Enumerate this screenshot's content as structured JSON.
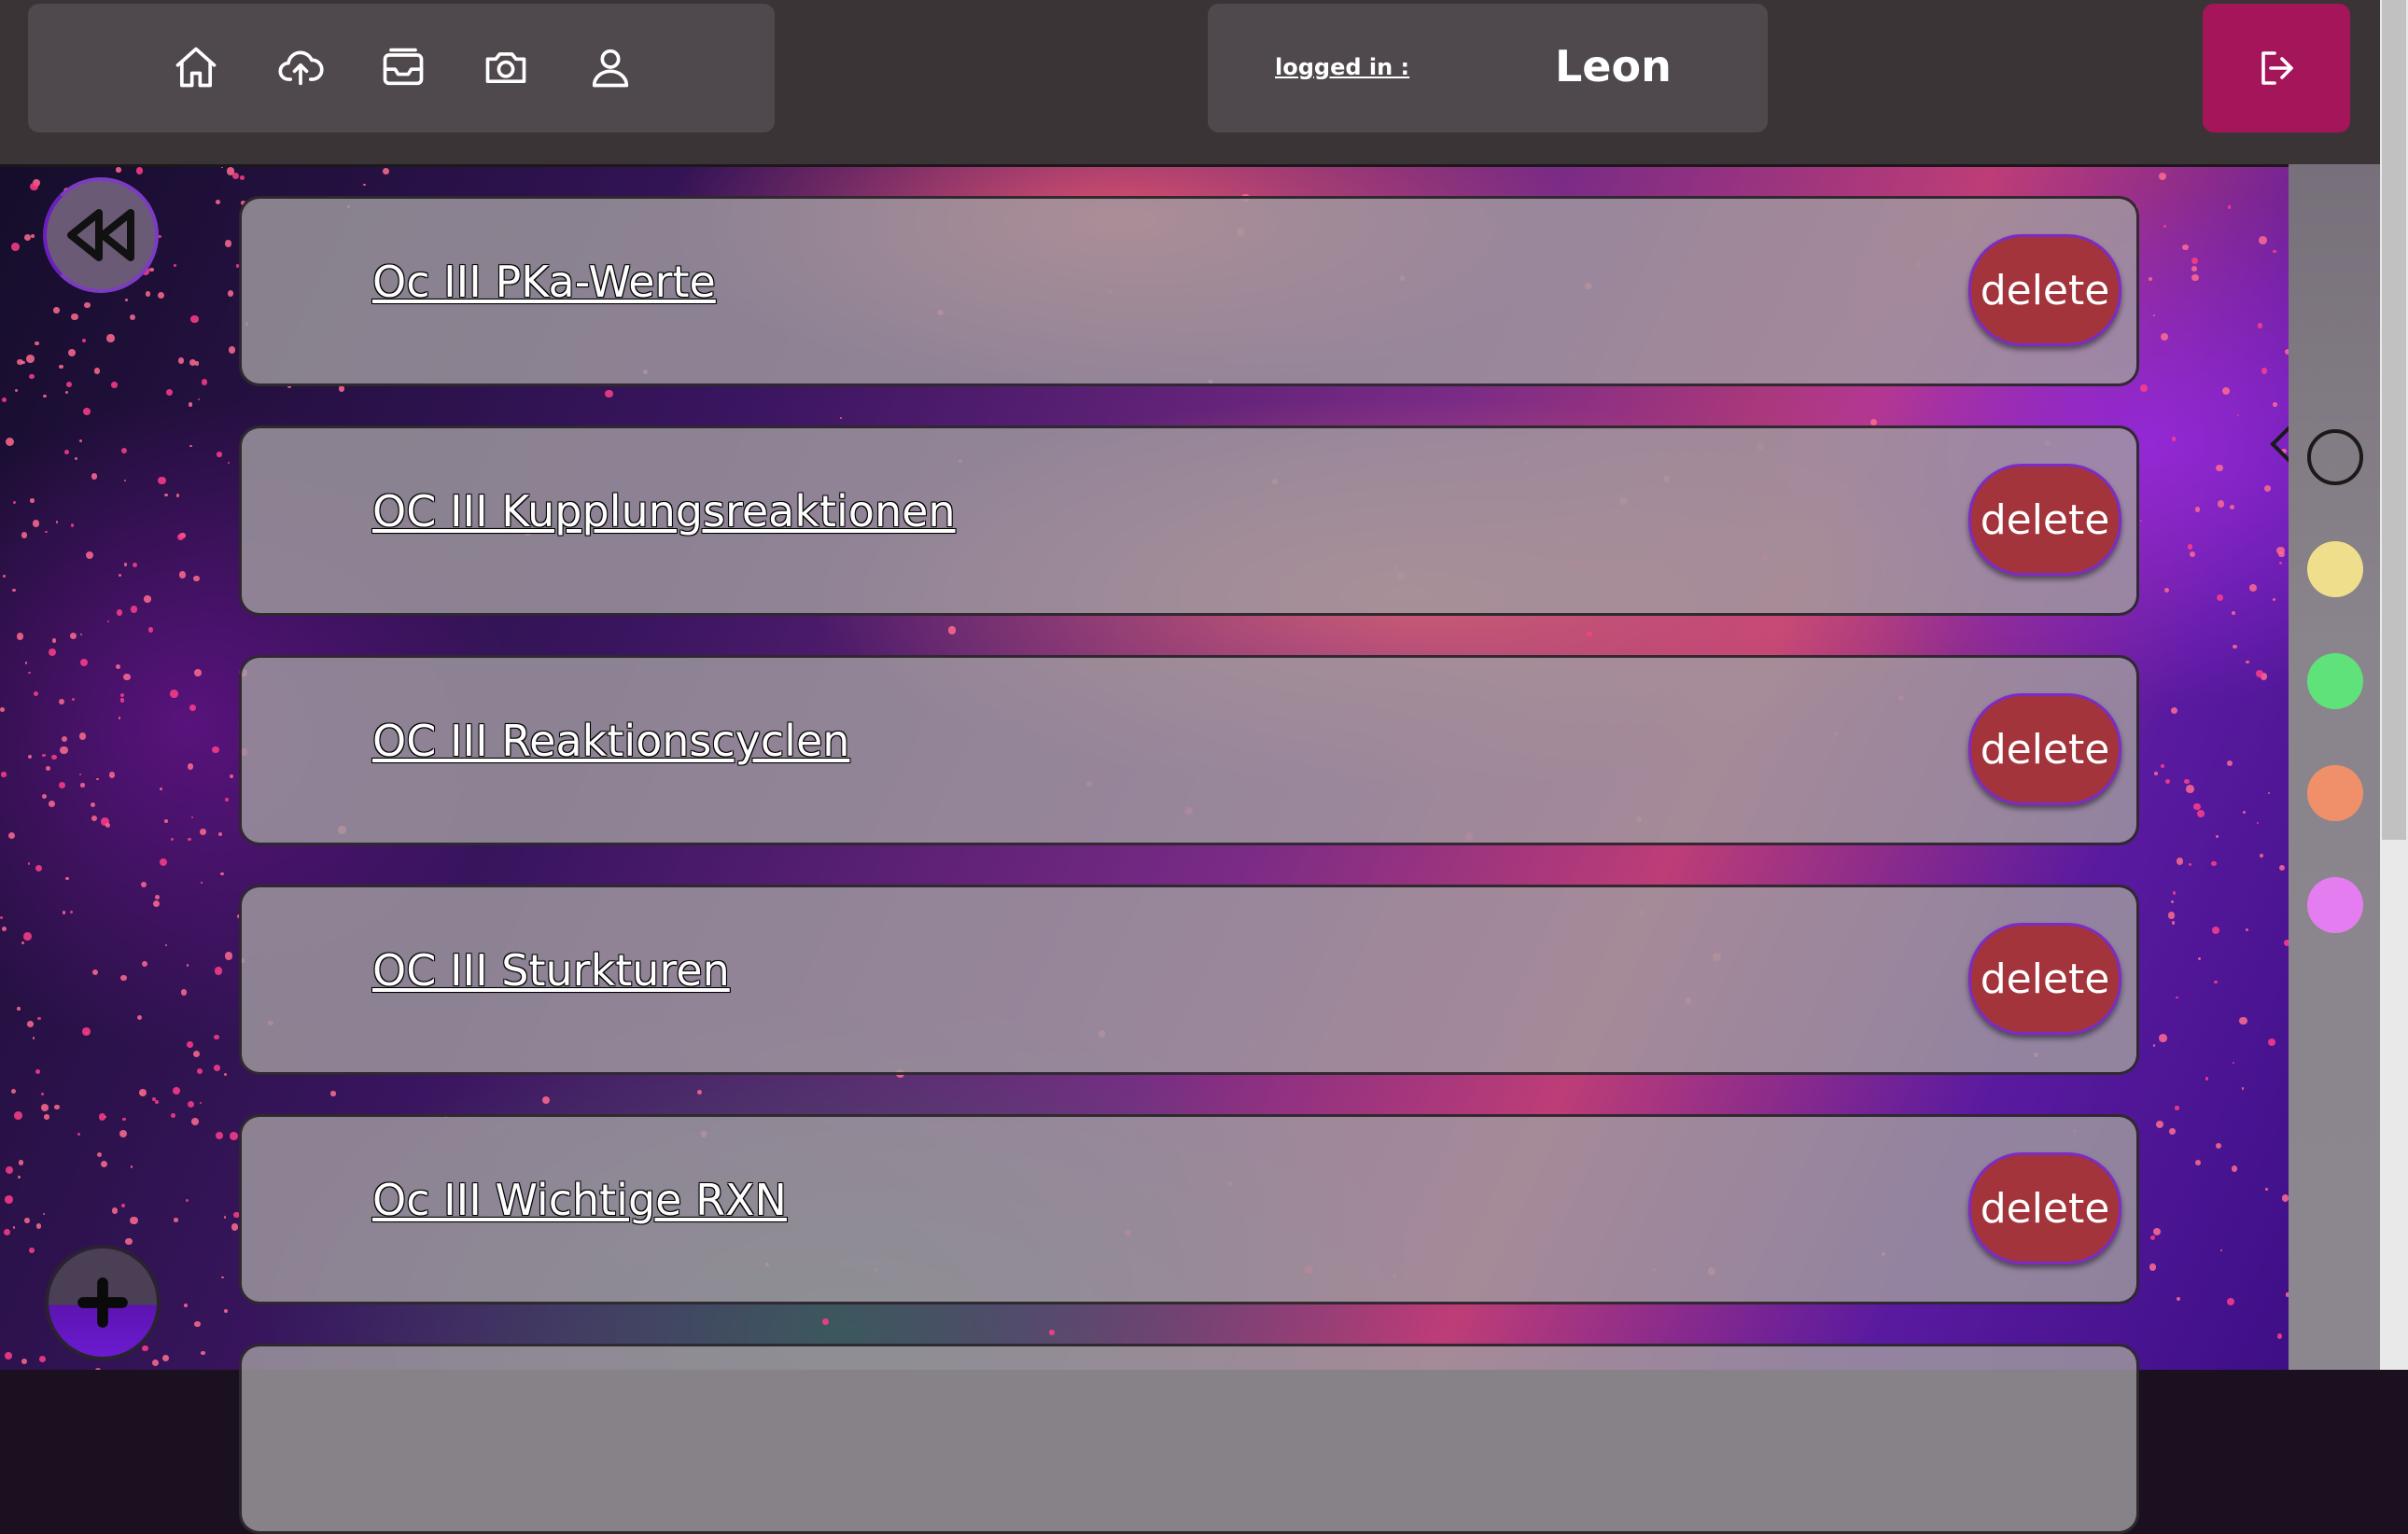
{
  "header": {
    "nav_icons": [
      "home-icon",
      "cloud-upload-icon",
      "inbox-icon",
      "camera-icon",
      "user-icon"
    ],
    "logged_in_label": "logged in :",
    "user_name": "Leon",
    "logout_icon": "logout-icon",
    "logout_color": "#a5155a"
  },
  "documents": [
    {
      "title": "Oc III PKa-Werte",
      "delete_label": "delete"
    },
    {
      "title": "OC III Kupplungsreaktionen",
      "delete_label": "delete"
    },
    {
      "title": "OC III Reaktionscyclen",
      "delete_label": "delete"
    },
    {
      "title": "OC III Sturkturen",
      "delete_label": "delete"
    },
    {
      "title": "Oc III Wichtige RXN",
      "delete_label": "delete"
    }
  ],
  "color_filters": [
    {
      "name": "none",
      "color": "transparent",
      "selected": true
    },
    {
      "name": "yellow",
      "color": "#efdf8c",
      "selected": false
    },
    {
      "name": "green",
      "color": "#5fe27a",
      "selected": false
    },
    {
      "name": "orange",
      "color": "#f0906a",
      "selected": false
    },
    {
      "name": "pink",
      "color": "#e47ef0",
      "selected": false
    }
  ],
  "floating": {
    "back_icon": "rewind-icon",
    "add_icon": "plus-icon"
  }
}
